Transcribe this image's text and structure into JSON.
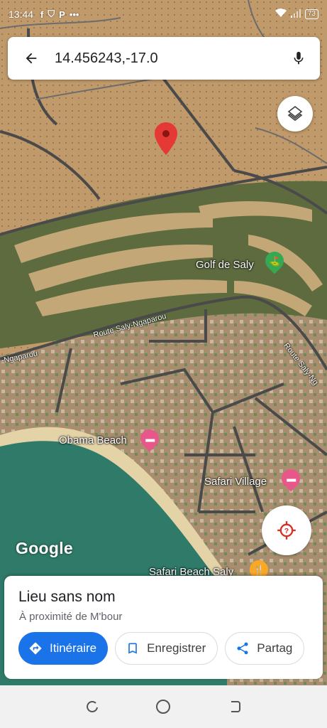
{
  "status_bar": {
    "time": "13:44",
    "battery": "73",
    "left_icons": [
      "facebook-icon",
      "shield-icon",
      "parking-icon",
      "more-dots-icon"
    ],
    "right_icons": [
      "wifi-icon",
      "signal-icon",
      "battery-icon"
    ]
  },
  "search": {
    "query": "14.456243,-17.0",
    "back_icon": "arrow-back-icon",
    "mic_icon": "microphone-icon"
  },
  "map": {
    "labels": {
      "golf": "Golf de Saly",
      "road_saly_ngaparou": "Route Saly-Ngaparou",
      "road_ngaparou_left": "-Ngaparou",
      "road_right": "Route Saly-Ng",
      "obama_beach": "Obama Beach",
      "safari_village": "Safari Village",
      "safari_beach": "Safari Beach Saly"
    },
    "pin_color": "#e53935",
    "poi_hotel_color": "#e8578a",
    "poi_golf_color": "#34a853",
    "poi_restaurant_color": "#f9a825",
    "logo": "Google"
  },
  "buttons": {
    "layers_icon": "layers-icon",
    "location_icon": "my-location-icon"
  },
  "place": {
    "title": "Lieu sans nom",
    "subtitle": "À proximité de M'bour",
    "actions": [
      {
        "label": "Itinéraire",
        "icon": "directions-icon"
      },
      {
        "label": "Enregistrer",
        "icon": "bookmark-icon"
      },
      {
        "label": "Partag",
        "icon": "share-icon"
      }
    ]
  },
  "colors": {
    "accent": "#1a73e8",
    "sea": "#2f7a68"
  },
  "nav_bar": {
    "icons": [
      "recent-apps-icon",
      "home-icon",
      "back-icon"
    ]
  }
}
